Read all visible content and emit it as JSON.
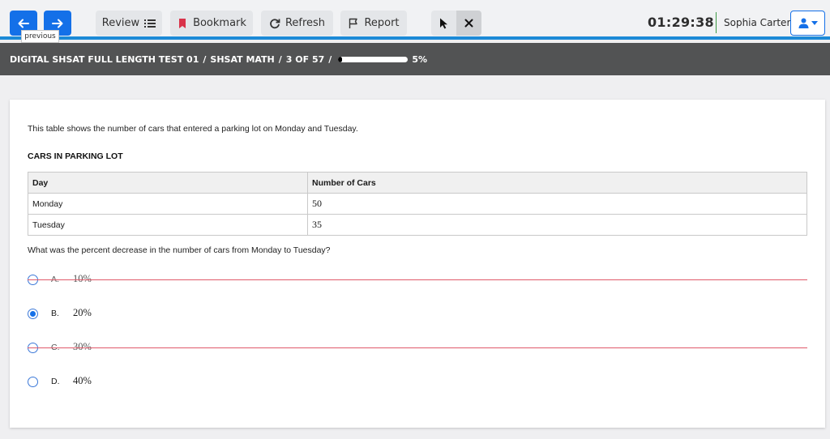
{
  "toolbar": {
    "prev_tooltip": "previous",
    "review_label": "Review",
    "bookmark_label": "Bookmark",
    "refresh_label": "Refresh",
    "report_label": "Report",
    "timer": "01:29:38",
    "user_name": "Sophia Carter",
    "colors": {
      "nav_blue": "#1470e8",
      "accent_line": "#1c8ad7",
      "bookmark_red": "#d9334a"
    }
  },
  "breadcrumb": {
    "test": "DIGITAL SHSAT FULL LENGTH TEST 01",
    "sep1": "/",
    "section": "SHSAT MATH",
    "sep2": "/",
    "position": "3 OF 57",
    "sep3": "/",
    "progress_percent": 5,
    "progress_label": "5%"
  },
  "question": {
    "intro": "This table shows the number of cars that entered a parking lot on Monday and Tuesday.",
    "table_title": "CARS IN PARKING LOT",
    "table": {
      "headers": [
        "Day",
        "Number of Cars"
      ],
      "rows": [
        [
          "Monday",
          "50"
        ],
        [
          "Tuesday",
          "35"
        ]
      ]
    },
    "prompt": "What was the percent decrease in the number of cars from Monday to Tuesday?",
    "choices": [
      {
        "letter": "A.",
        "text": "10%",
        "selected": false,
        "struck": true
      },
      {
        "letter": "B.",
        "text": "20%",
        "selected": true,
        "struck": false
      },
      {
        "letter": "C.",
        "text": "30%",
        "selected": false,
        "struck": true
      },
      {
        "letter": "D.",
        "text": "40%",
        "selected": false,
        "struck": false
      }
    ]
  }
}
